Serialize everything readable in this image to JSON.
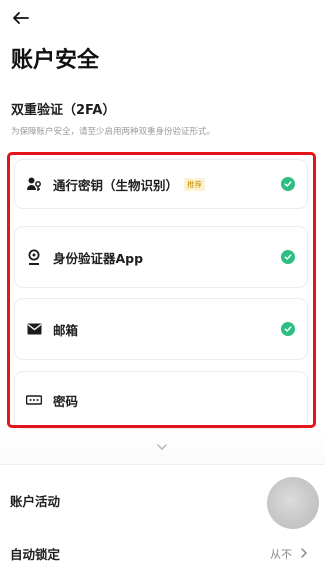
{
  "header": {
    "title": "账户安全"
  },
  "two_factor": {
    "title": "双重验证（2FA）",
    "description": "为保障账户安全，请至少启用两种双重身份验证形式。",
    "methods": [
      {
        "label": "通行密钥（生物识别）",
        "badge": "推荐",
        "icon": "passkey-icon",
        "enabled": true
      },
      {
        "label": "身份验证器App",
        "icon": "authenticator-icon",
        "enabled": true
      },
      {
        "label": "邮箱",
        "icon": "email-icon",
        "enabled": true
      },
      {
        "label": "密码",
        "icon": "password-icon",
        "enabled": false
      }
    ]
  },
  "rows": {
    "account_activity": {
      "label": "账户活动"
    },
    "auto_lock": {
      "label": "自动锁定",
      "value": "从不"
    }
  },
  "colors": {
    "check": "#2ebd85",
    "badge_text": "#c99400",
    "highlight": "#e4141b"
  }
}
